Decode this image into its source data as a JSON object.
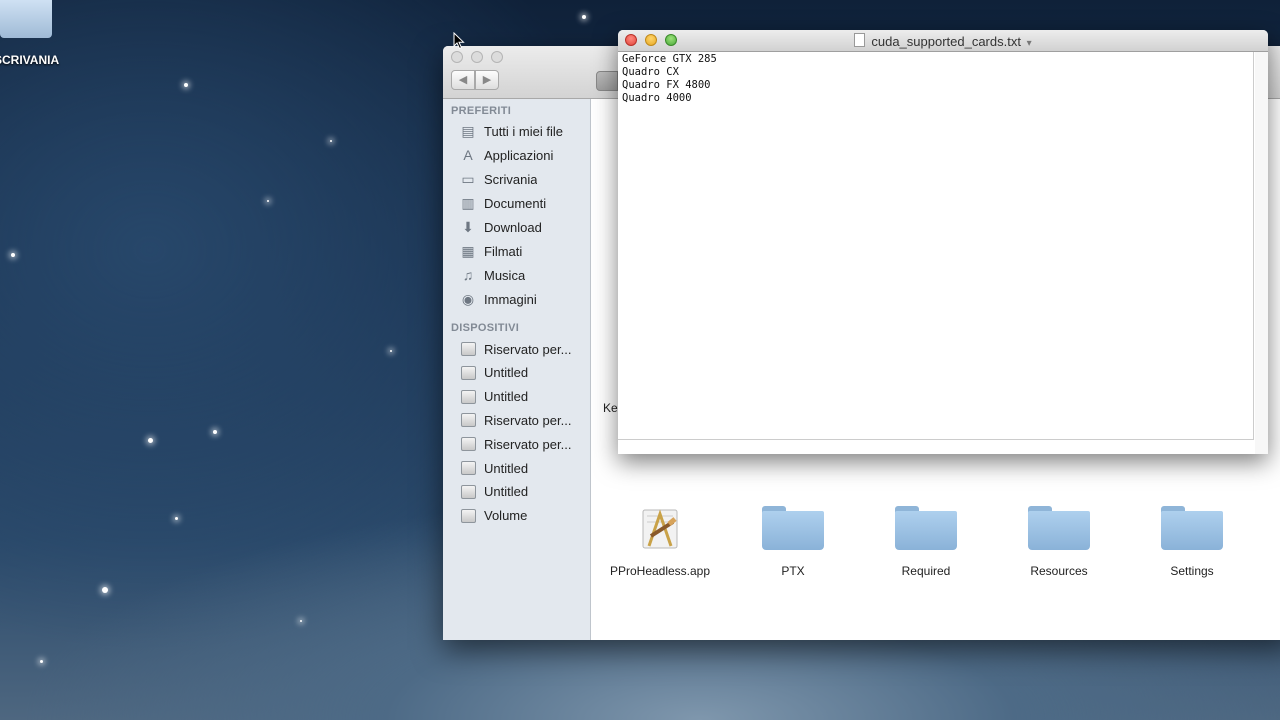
{
  "desktop": {
    "icon_label": "SCRIVANIA"
  },
  "finder": {
    "nav": {
      "back": "◀",
      "forward": "▶"
    },
    "sidebar": {
      "favorites_header": "PREFERITI",
      "favorites": [
        {
          "label": "Tutti i miei file",
          "icon": "all-files-icon",
          "glyph": "▤"
        },
        {
          "label": "Applicazioni",
          "icon": "applications-icon",
          "glyph": "A"
        },
        {
          "label": "Scrivania",
          "icon": "desktop-icon",
          "glyph": "▭"
        },
        {
          "label": "Documenti",
          "icon": "documents-icon",
          "glyph": "▥"
        },
        {
          "label": "Download",
          "icon": "download-icon",
          "glyph": "⬇"
        },
        {
          "label": "Filmati",
          "icon": "movies-icon",
          "glyph": "▦"
        },
        {
          "label": "Musica",
          "icon": "music-icon",
          "glyph": "♫"
        },
        {
          "label": "Immagini",
          "icon": "pictures-icon",
          "glyph": "◉"
        }
      ],
      "devices_header": "DISPOSITIVI",
      "devices": [
        {
          "label": "Riservato per..."
        },
        {
          "label": "Untitled"
        },
        {
          "label": "Untitled"
        },
        {
          "label": "Riservato per..."
        },
        {
          "label": "Riservato per..."
        },
        {
          "label": "Untitled"
        },
        {
          "label": "Untitled"
        },
        {
          "label": "Volume"
        }
      ]
    },
    "files": [
      {
        "name": "PProHeadless.app",
        "kind": "app"
      },
      {
        "name": "PTX",
        "kind": "folder"
      },
      {
        "name": "Required",
        "kind": "folder"
      },
      {
        "name": "Resources",
        "kind": "folder"
      },
      {
        "name": "Settings",
        "kind": "folder"
      }
    ],
    "partial_label": "Ke"
  },
  "textedit": {
    "title": "cuda_supported_cards.txt",
    "title_menu_glyph": "▾",
    "lines": [
      "GeForce GTX 285",
      "Quadro CX",
      "Quadro FX 4800",
      "Quadro 4000"
    ]
  }
}
